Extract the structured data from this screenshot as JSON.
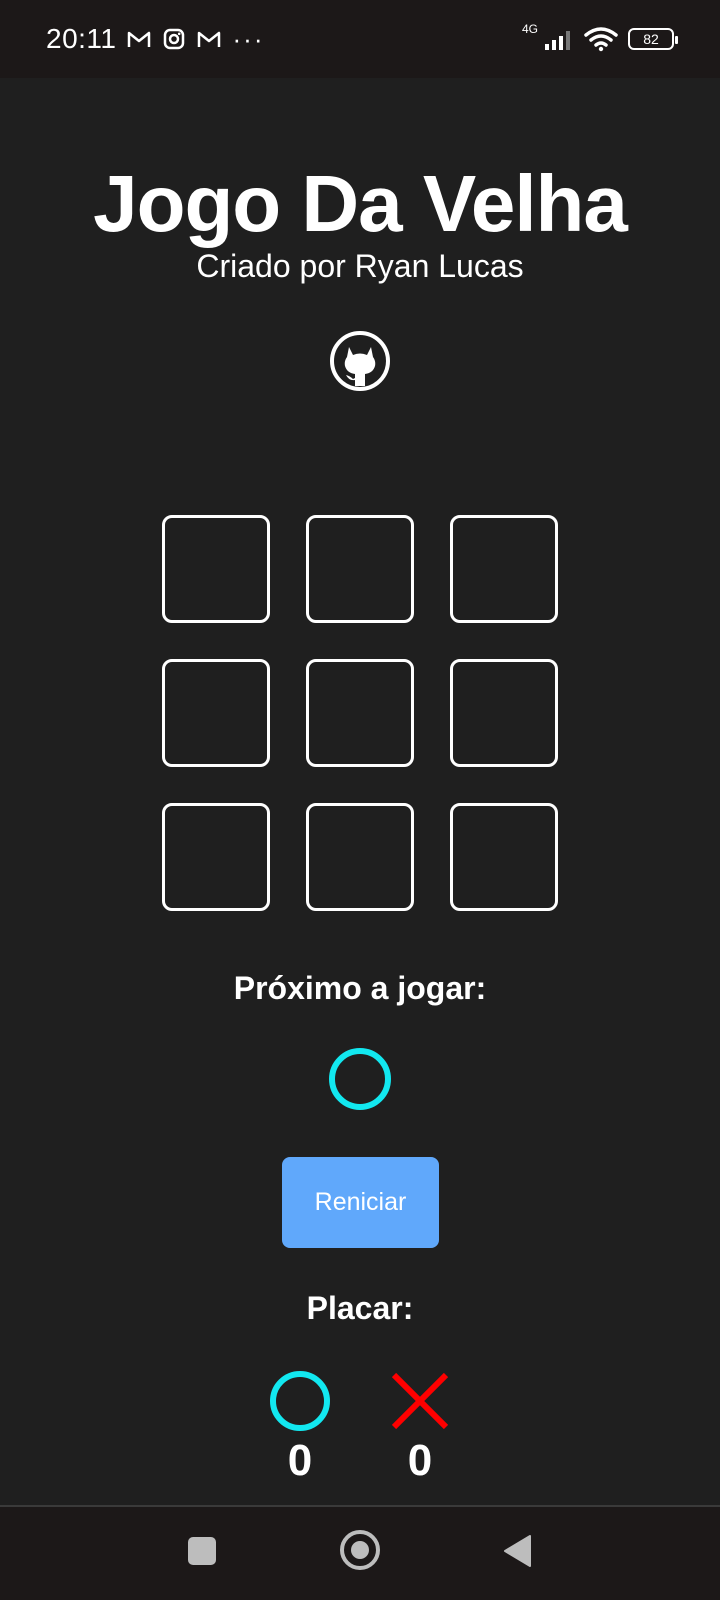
{
  "status_bar": {
    "time": "20:11",
    "left_icons": [
      "gmail-icon",
      "instagram-icon",
      "gmail-icon"
    ],
    "more": "···",
    "network": "4G",
    "battery": "82"
  },
  "header": {
    "title": "Jogo Da Velha",
    "subtitle": "Criado por Ryan Lucas",
    "github_icon": "github-icon"
  },
  "board": {
    "cells": [
      "",
      "",
      "",
      "",
      "",
      "",
      "",
      "",
      ""
    ]
  },
  "turn": {
    "label": "Próximo a jogar:",
    "current_player": "O"
  },
  "restart_label": "Reniciar",
  "score": {
    "label": "Placar:",
    "o": 0,
    "x": 0
  },
  "colors": {
    "background": "#1f1f1f",
    "o_color": "#12e8f0",
    "x_color": "#ff0000",
    "button": "#60a8fb"
  },
  "nav": {
    "icons": [
      "recent-apps-icon",
      "home-icon",
      "back-icon"
    ]
  }
}
